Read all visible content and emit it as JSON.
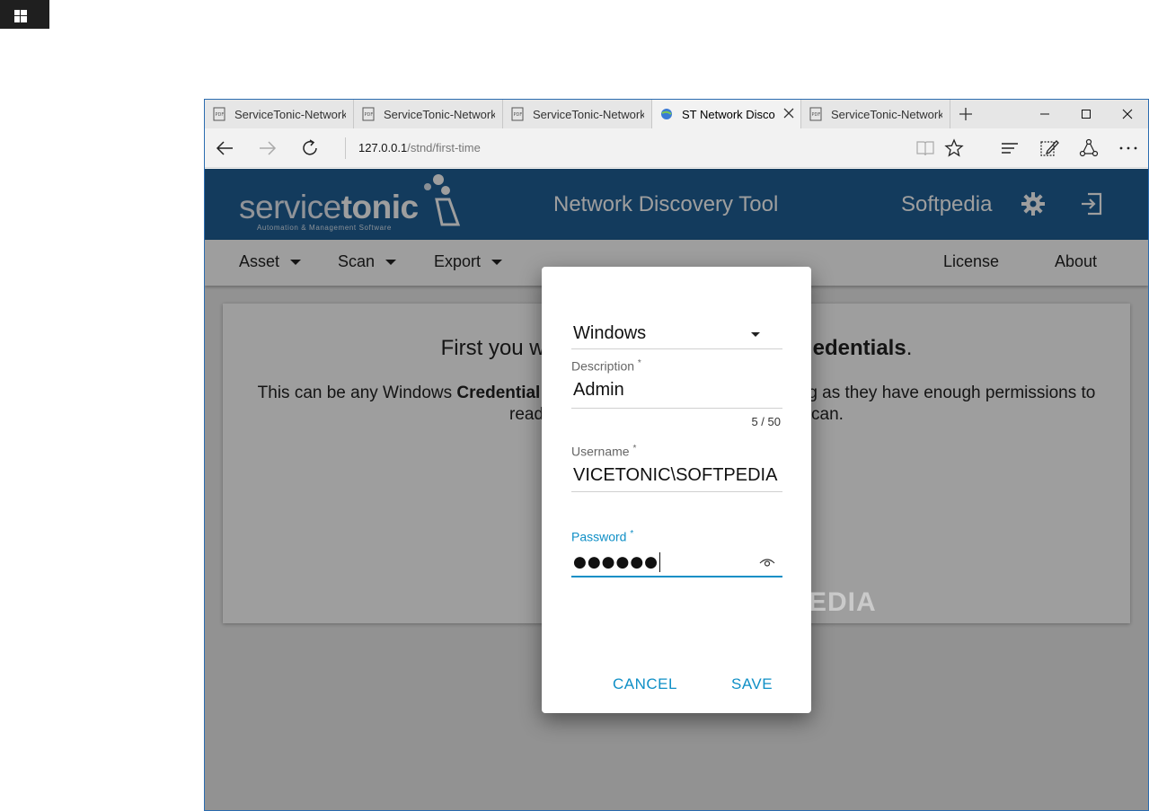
{
  "os": {
    "start_icon": "windows-logo-icon"
  },
  "browser": {
    "tabs": [
      {
        "label": "ServiceTonic-Network",
        "icon": "pdf-icon"
      },
      {
        "label": "ServiceTonic-Network",
        "icon": "pdf-icon"
      },
      {
        "label": "ServiceTonic-Network",
        "icon": "pdf-icon"
      },
      {
        "label": "ST Network Disco",
        "icon": "globe-icon",
        "active": true
      },
      {
        "label": "ServiceTonic-Network",
        "icon": "pdf-icon"
      }
    ],
    "url_host": "127.0.0.1",
    "url_path": "/stnd/first-time"
  },
  "app": {
    "logo_thin": "service",
    "logo_bold": "tonic",
    "logo_tagline": "Automation & Management Software",
    "title": "Network Discovery Tool",
    "user": "Softpedia",
    "accent": "#1f5f96",
    "menu": {
      "asset": "Asset",
      "scan": "Scan",
      "export": "Export",
      "license": "License",
      "about": "About"
    }
  },
  "card": {
    "line1_a": "First you w",
    "line1_b": "edentials",
    "line1_c": ".",
    "line2_a": "This can be any Windows ",
    "line2_b": "Credential",
    "line2_c": "g as they have enough permissions to",
    "line3_a": "read",
    "line3_b": "can."
  },
  "dialog": {
    "type_value": "Windows",
    "description_label": "Description",
    "description_value": "Admin",
    "description_counter": "5 / 50",
    "username_label": "Username",
    "username_value": "VICETONIC\\SOFTPEDIA",
    "password_label": "Password",
    "password_mask": "●●●●●●",
    "required_mark": "*",
    "cancel": "CANCEL",
    "save": "SAVE",
    "focus_color": "#0f8fc6"
  },
  "watermark": "SOFTPEDIA"
}
